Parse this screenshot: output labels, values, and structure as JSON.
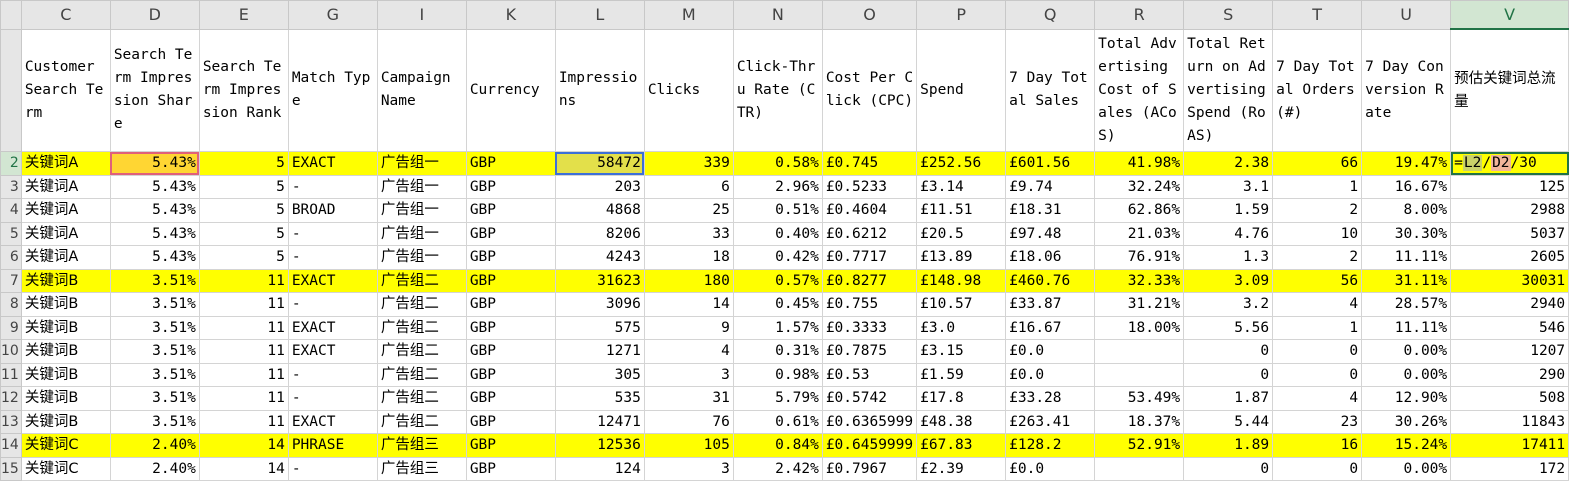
{
  "columns": [
    "C",
    "D",
    "E",
    "G",
    "I",
    "K",
    "L",
    "M",
    "N",
    "O",
    "P",
    "Q",
    "R",
    "S",
    "T",
    "U",
    "V"
  ],
  "header_row_number": "",
  "headers": [
    "Customer Search Term",
    "Search Term Impression Share",
    "Search Term Impression Rank",
    "Match Type",
    "Campaign Name",
    "Currency",
    "Impressions",
    "Clicks",
    "Click-Thru Rate (CTR)",
    "Cost Per Click (CPC)",
    "Spend",
    "7 Day Total Sales",
    "Total Advertising Cost of Sales (ACoS)",
    "Total Return on Advertising Spend (RoAS)",
    "7 Day Total Orders (#)",
    "7 Day Conversion Rate",
    "预估关键词总流量"
  ],
  "formula": {
    "eq": "=",
    "ref1": "L2",
    "slash1": "/",
    "ref2": "D2",
    "tail": "/30"
  },
  "rows": [
    {
      "num": "2",
      "hl": true,
      "cells": [
        "关键词A",
        "5.43%",
        "5",
        "EXACT",
        "广告组一",
        "GBP",
        "58472",
        "339",
        "0.58%",
        "£0.745",
        "£252.56",
        "£601.56",
        "41.98%",
        "2.38",
        "66",
        "19.47%",
        ""
      ]
    },
    {
      "num": "3",
      "hl": false,
      "cells": [
        "关键词A",
        "5.43%",
        "5",
        "-",
        "广告组一",
        "GBP",
        "203",
        "6",
        "2.96%",
        "£0.5233",
        "£3.14",
        "£9.74",
        "32.24%",
        "3.1",
        "1",
        "16.67%",
        "125"
      ]
    },
    {
      "num": "4",
      "hl": false,
      "cells": [
        "关键词A",
        "5.43%",
        "5",
        "BROAD",
        "广告组一",
        "GBP",
        "4868",
        "25",
        "0.51%",
        "£0.4604",
        "£11.51",
        "£18.31",
        "62.86%",
        "1.59",
        "2",
        "8.00%",
        "2988"
      ]
    },
    {
      "num": "5",
      "hl": false,
      "cells": [
        "关键词A",
        "5.43%",
        "5",
        "-",
        "广告组一",
        "GBP",
        "8206",
        "33",
        "0.40%",
        "£0.6212",
        "£20.5",
        "£97.48",
        "21.03%",
        "4.76",
        "10",
        "30.30%",
        "5037"
      ]
    },
    {
      "num": "6",
      "hl": false,
      "cells": [
        "关键词A",
        "5.43%",
        "5",
        "-",
        "广告组一",
        "GBP",
        "4243",
        "18",
        "0.42%",
        "£0.7717",
        "£13.89",
        "£18.06",
        "76.91%",
        "1.3",
        "2",
        "11.11%",
        "2605"
      ]
    },
    {
      "num": "7",
      "hl": true,
      "cells": [
        "关键词B",
        "3.51%",
        "11",
        "EXACT",
        "广告组二",
        "GBP",
        "31623",
        "180",
        "0.57%",
        "£0.8277",
        "£148.98",
        "£460.76",
        "32.33%",
        "3.09",
        "56",
        "31.11%",
        "30031"
      ]
    },
    {
      "num": "8",
      "hl": false,
      "cells": [
        "关键词B",
        "3.51%",
        "11",
        "-",
        "广告组二",
        "GBP",
        "3096",
        "14",
        "0.45%",
        "£0.755",
        "£10.57",
        "£33.87",
        "31.21%",
        "3.2",
        "4",
        "28.57%",
        "2940"
      ]
    },
    {
      "num": "9",
      "hl": false,
      "cells": [
        "关键词B",
        "3.51%",
        "11",
        "EXACT",
        "广告组二",
        "GBP",
        "575",
        "9",
        "1.57%",
        "£0.3333",
        "£3.0",
        "£16.67",
        "18.00%",
        "5.56",
        "1",
        "11.11%",
        "546"
      ]
    },
    {
      "num": "10",
      "hl": false,
      "cells": [
        "关键词B",
        "3.51%",
        "11",
        "EXACT",
        "广告组二",
        "GBP",
        "1271",
        "4",
        "0.31%",
        "£0.7875",
        "£3.15",
        "£0.0",
        "",
        "0",
        "0",
        "0.00%",
        "1207"
      ]
    },
    {
      "num": "11",
      "hl": false,
      "cells": [
        "关键词B",
        "3.51%",
        "11",
        "-",
        "广告组二",
        "GBP",
        "305",
        "3",
        "0.98%",
        "£0.53",
        "£1.59",
        "£0.0",
        "",
        "0",
        "0",
        "0.00%",
        "290"
      ]
    },
    {
      "num": "12",
      "hl": false,
      "cells": [
        "关键词B",
        "3.51%",
        "11",
        "-",
        "广告组二",
        "GBP",
        "535",
        "31",
        "5.79%",
        "£0.5742",
        "£17.8",
        "£33.28",
        "53.49%",
        "1.87",
        "4",
        "12.90%",
        "508"
      ]
    },
    {
      "num": "13",
      "hl": false,
      "cells": [
        "关键词B",
        "3.51%",
        "11",
        "EXACT",
        "广告组二",
        "GBP",
        "12471",
        "76",
        "0.61%",
        "£0.6365999",
        "£48.38",
        "£263.41",
        "18.37%",
        "5.44",
        "23",
        "30.26%",
        "11843"
      ]
    },
    {
      "num": "14",
      "hl": true,
      "cells": [
        "关键词C",
        "2.40%",
        "14",
        "PHRASE",
        "广告组三",
        "GBP",
        "12536",
        "105",
        "0.84%",
        "£0.6459999",
        "£67.83",
        "£128.2",
        "52.91%",
        "1.89",
        "16",
        "15.24%",
        "17411"
      ]
    },
    {
      "num": "15",
      "hl": false,
      "cells": [
        "关键词C",
        "2.40%",
        "14",
        "-",
        "广告组三",
        "GBP",
        "124",
        "3",
        "2.42%",
        "£0.7967",
        "£2.39",
        "£0.0",
        "",
        "0",
        "0",
        "0.00%",
        "172"
      ]
    }
  ]
}
